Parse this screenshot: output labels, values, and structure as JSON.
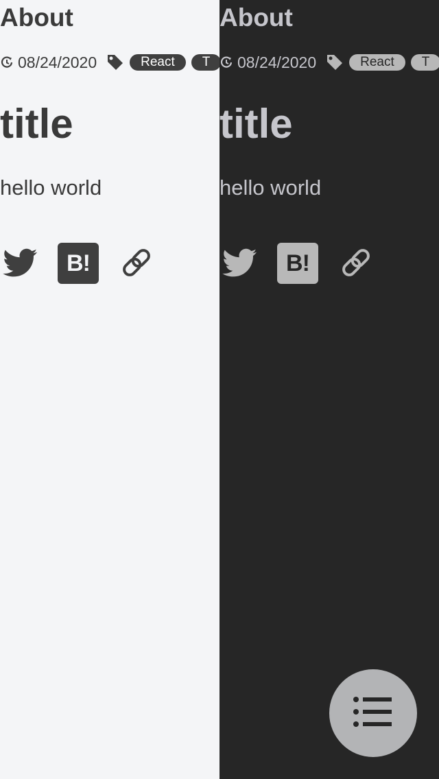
{
  "page_title": "About",
  "post": {
    "date": "08/24/2020",
    "tags": [
      "React",
      "T"
    ],
    "title": "title",
    "body": "hello world"
  },
  "share": {
    "hatena_label": "B!",
    "icons": [
      "twitter-icon",
      "hatena-bookmark-icon",
      "link-icon"
    ]
  },
  "themes": {
    "light": {
      "background": "#f4f5f7",
      "text": "#3a3a3a",
      "icon": "#3f3f3f"
    },
    "dark": {
      "background": "#262626",
      "text": "#c6c6cc",
      "icon": "#b8b8b8"
    }
  },
  "fab": {
    "icon": "list-icon",
    "color": "#b3b4b6"
  }
}
